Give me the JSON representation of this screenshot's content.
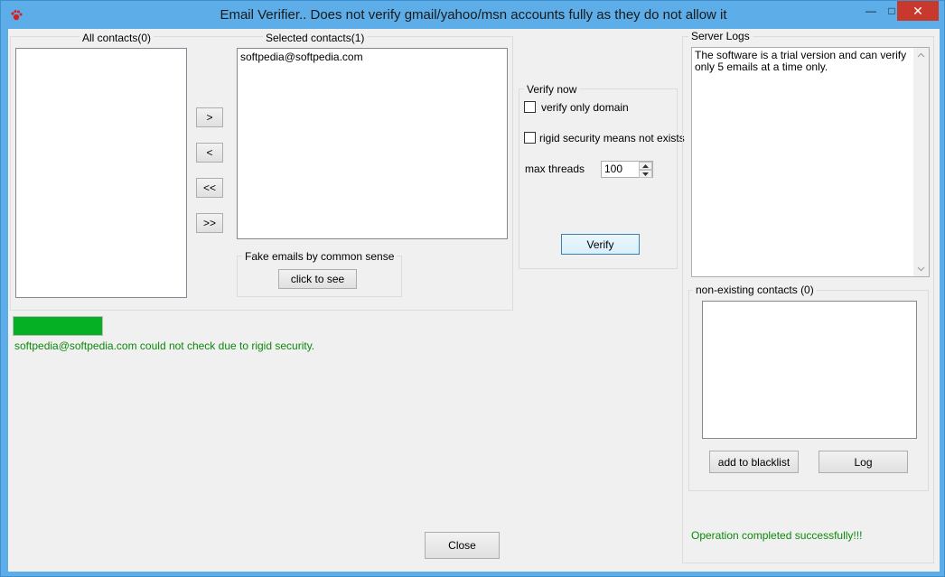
{
  "window": {
    "title": "Email Verifier.. Does not verify gmail/yahoo/msn accounts fully  as they do not allow it",
    "close_glyph": "✕",
    "maximize_glyph": "□",
    "minimize_glyph": "—"
  },
  "contacts": {
    "all_label": "All contacts(0)",
    "selected_label": "Selected contacts(1)",
    "selected_items": [
      "softpedia@softpedia.com"
    ],
    "move_right_label": ">",
    "move_left_label": "<",
    "move_all_left_label": "<<",
    "move_all_right_label": ">>"
  },
  "fake_emails": {
    "group_label": "Fake emails by common sense",
    "button_label": "click to see"
  },
  "verify": {
    "group_label": "Verify now",
    "only_domain_label": "verify only domain",
    "only_domain_checked": false,
    "rigid_security_label": "rigid security means not exists",
    "rigid_security_checked": false,
    "max_threads_label": "max threads",
    "max_threads_value": "100",
    "button_label": "Verify"
  },
  "progress": {
    "fraction": 1.0,
    "color": "#06b025"
  },
  "status_message": "softpedia@softpedia.com could not check due to rigid security.",
  "server_logs": {
    "label": "Server Logs",
    "text": "The software is a trial version and can verify only 5 emails at a time only."
  },
  "non_existing": {
    "group_label": "non-existing contacts (0)",
    "add_blacklist_label": "add to blacklist",
    "log_label": "Log"
  },
  "operation_status": "Operation completed successfully!!!",
  "close_button_label": "Close",
  "colors": {
    "title_bar": "#5dade8",
    "close_button": "#c7392d",
    "status_green": "#0a8a0a"
  }
}
